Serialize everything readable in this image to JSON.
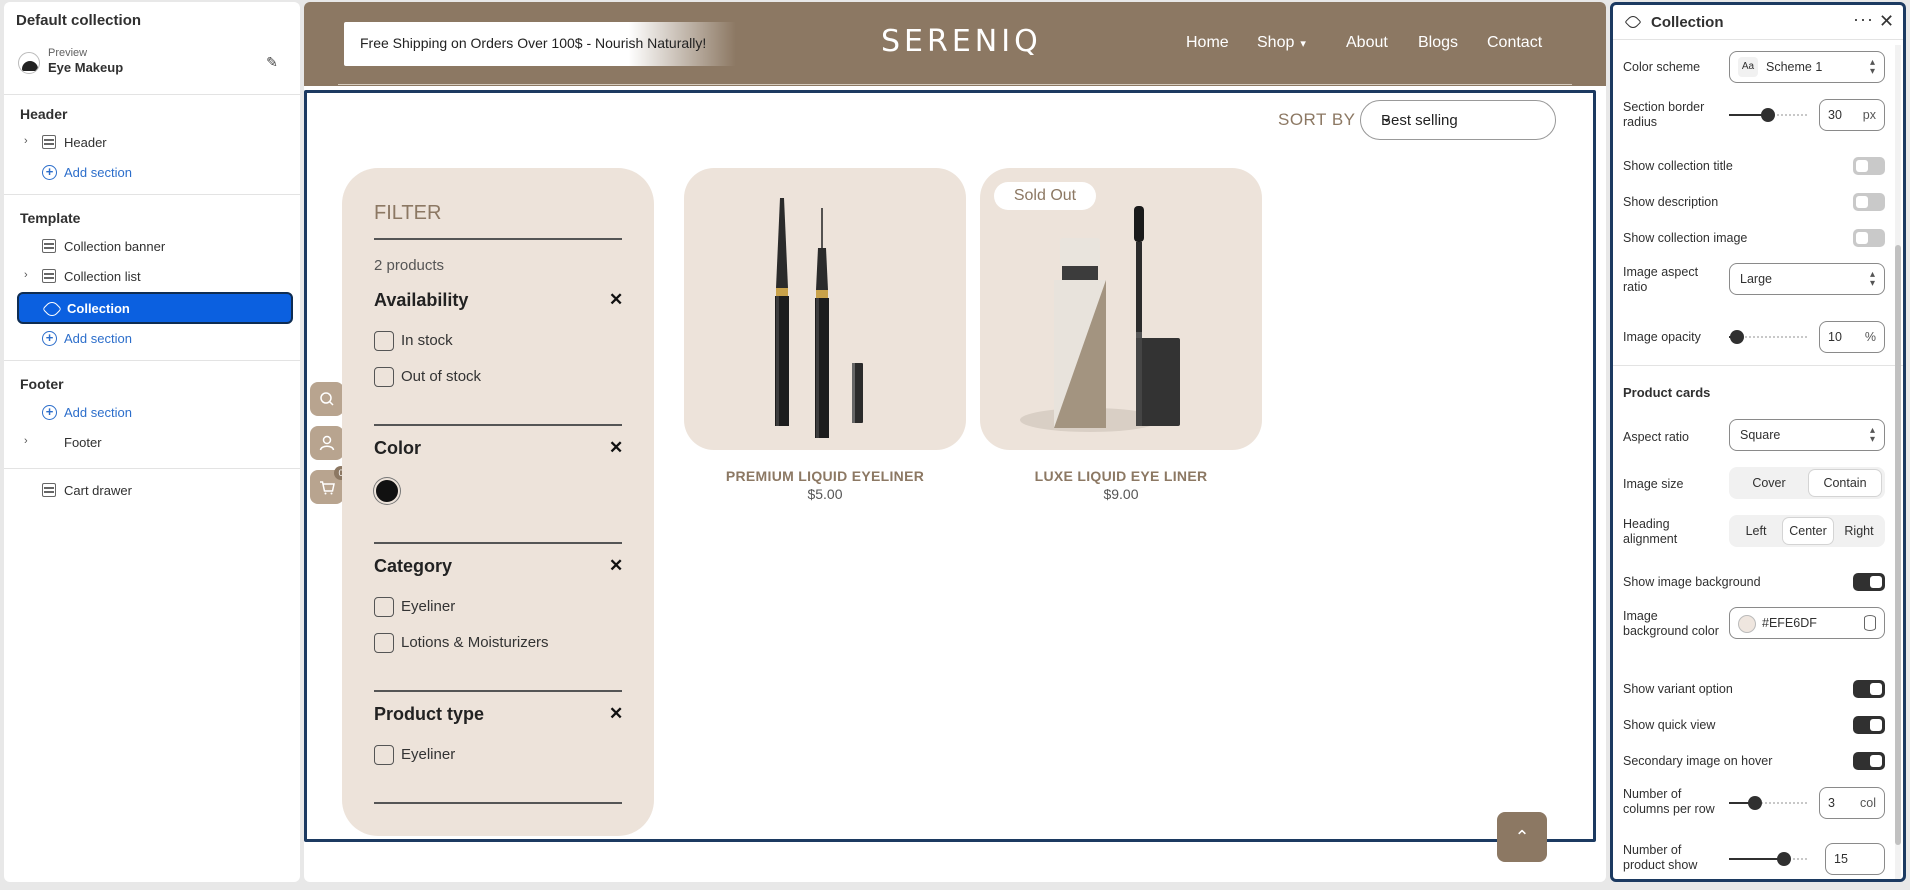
{
  "sidebar": {
    "title": "Default collection",
    "preview_label": "Preview",
    "preview_value": "Eye Makeup",
    "groups": {
      "header": "Header",
      "template": "Template",
      "footer": "Footer"
    },
    "items": {
      "header": "Header",
      "header_add": "Add section",
      "collection_banner": "Collection banner",
      "collection_list": "Collection list",
      "collection": "Collection",
      "template_add": "Add section",
      "footer_add": "Add section",
      "footer": "Footer",
      "cart_drawer": "Cart drawer"
    }
  },
  "store": {
    "promo": "Free Shipping on Orders Over 100$ - Nourish Naturally!",
    "brand": "SERENIQ",
    "nav": [
      "Home",
      "Shop",
      "About",
      "Blogs",
      "Contact"
    ],
    "sort_label": "SORT BY",
    "sort_value": "Best selling",
    "cart_count": "0",
    "accent_color": "#8C7863",
    "card_bg_color": "#EDE3DA"
  },
  "filter": {
    "title": "FILTER",
    "count": "2 products",
    "availability": "Availability",
    "in_stock": "In stock",
    "out_of_stock": "Out of stock",
    "color": "Color",
    "category": "Category",
    "cat_eyeliner": "Eyeliner",
    "cat_lotions": "Lotions & Moisturizers",
    "product_type": "Product type",
    "type_eyeliner": "Eyeliner"
  },
  "products": [
    {
      "name": "PREMIUM LIQUID EYELINER",
      "price": "$5.00",
      "badge": ""
    },
    {
      "name": "LUXE LIQUID EYE LINER",
      "price": "$9.00",
      "badge": "Sold Out"
    }
  ],
  "panel": {
    "title": "Collection",
    "color_scheme_label": "Color scheme",
    "color_scheme_value": "Scheme 1",
    "color_scheme_icon": "Aa",
    "border_radius_label": "Section border radius",
    "border_radius_value": "30",
    "border_radius_unit": "px",
    "border_radius_fraction": 0.5,
    "show_title_label": "Show collection title",
    "show_desc_label": "Show description",
    "show_image_label": "Show collection image",
    "aspect_label": "Image aspect ratio",
    "aspect_value": "Large",
    "opacity_label": "Image opacity",
    "opacity_value": "10",
    "opacity_unit": "%",
    "opacity_fraction": 0.1,
    "product_cards_heading": "Product cards",
    "card_aspect_label": "Aspect ratio",
    "card_aspect_value": "Square",
    "image_size_label": "Image size",
    "image_size_options": [
      "Cover",
      "Contain"
    ],
    "heading_align_label": "Heading alignment",
    "heading_align_options": [
      "Left",
      "Center",
      "Right"
    ],
    "show_img_bg_label": "Show image background",
    "img_bg_color_label": "Image background color",
    "img_bg_color_value": "#EFE6DF",
    "show_variant_label": "Show variant option",
    "show_quick_view_label": "Show quick view",
    "secondary_hover_label": "Secondary image on hover",
    "columns_label": "Number of columns per row",
    "columns_value": "3",
    "columns_unit": "col",
    "columns_fraction": 0.33,
    "product_show_label": "Number of product show",
    "product_show_value": "15",
    "product_show_fraction": 0.7
  }
}
